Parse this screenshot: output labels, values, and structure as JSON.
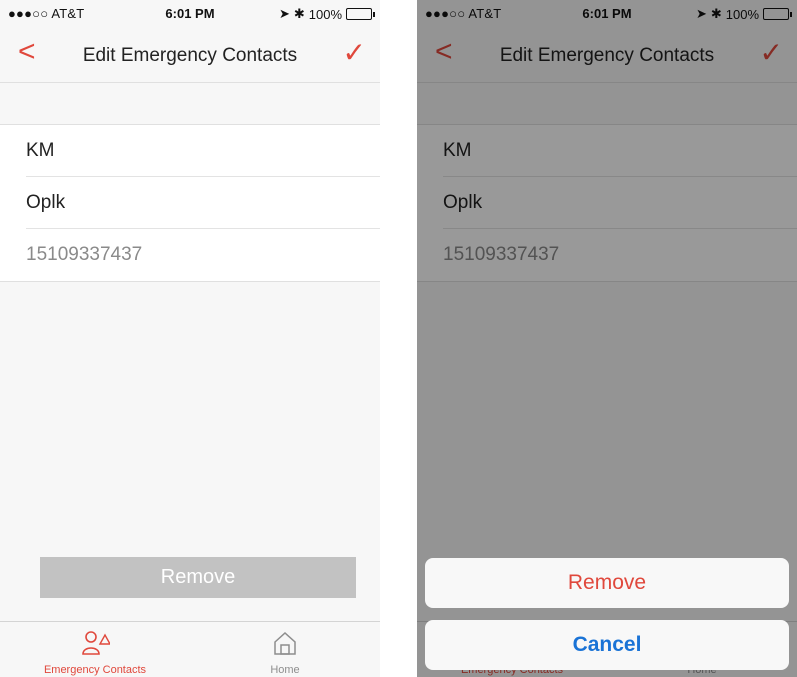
{
  "status_bar": {
    "carrier": "●●●○○ AT&T",
    "time": "6:01 PM",
    "location_icon": "➤",
    "bluetooth_icon": "✱",
    "battery": "100%",
    "battery_level": 1.0
  },
  "nav": {
    "back_symbol": "<",
    "title": "Edit Emergency Contacts",
    "done_symbol": "✓"
  },
  "contact": {
    "first_name": "KM",
    "last_name": "Oplk",
    "phone": "15109337437"
  },
  "remove_label": "Remove",
  "tabs": [
    {
      "label": "Emergency Contacts",
      "icon": "emergency-contacts-icon",
      "active": true
    },
    {
      "label": "Home",
      "icon": "home-icon",
      "active": false
    }
  ],
  "action_sheet": {
    "remove_label": "Remove",
    "cancel_label": "Cancel"
  },
  "colors": {
    "accent": "#e0483c",
    "cancel_blue": "#1a73d6",
    "battery_green": "#4cd964",
    "disabled_button": "#c2c2c2"
  }
}
